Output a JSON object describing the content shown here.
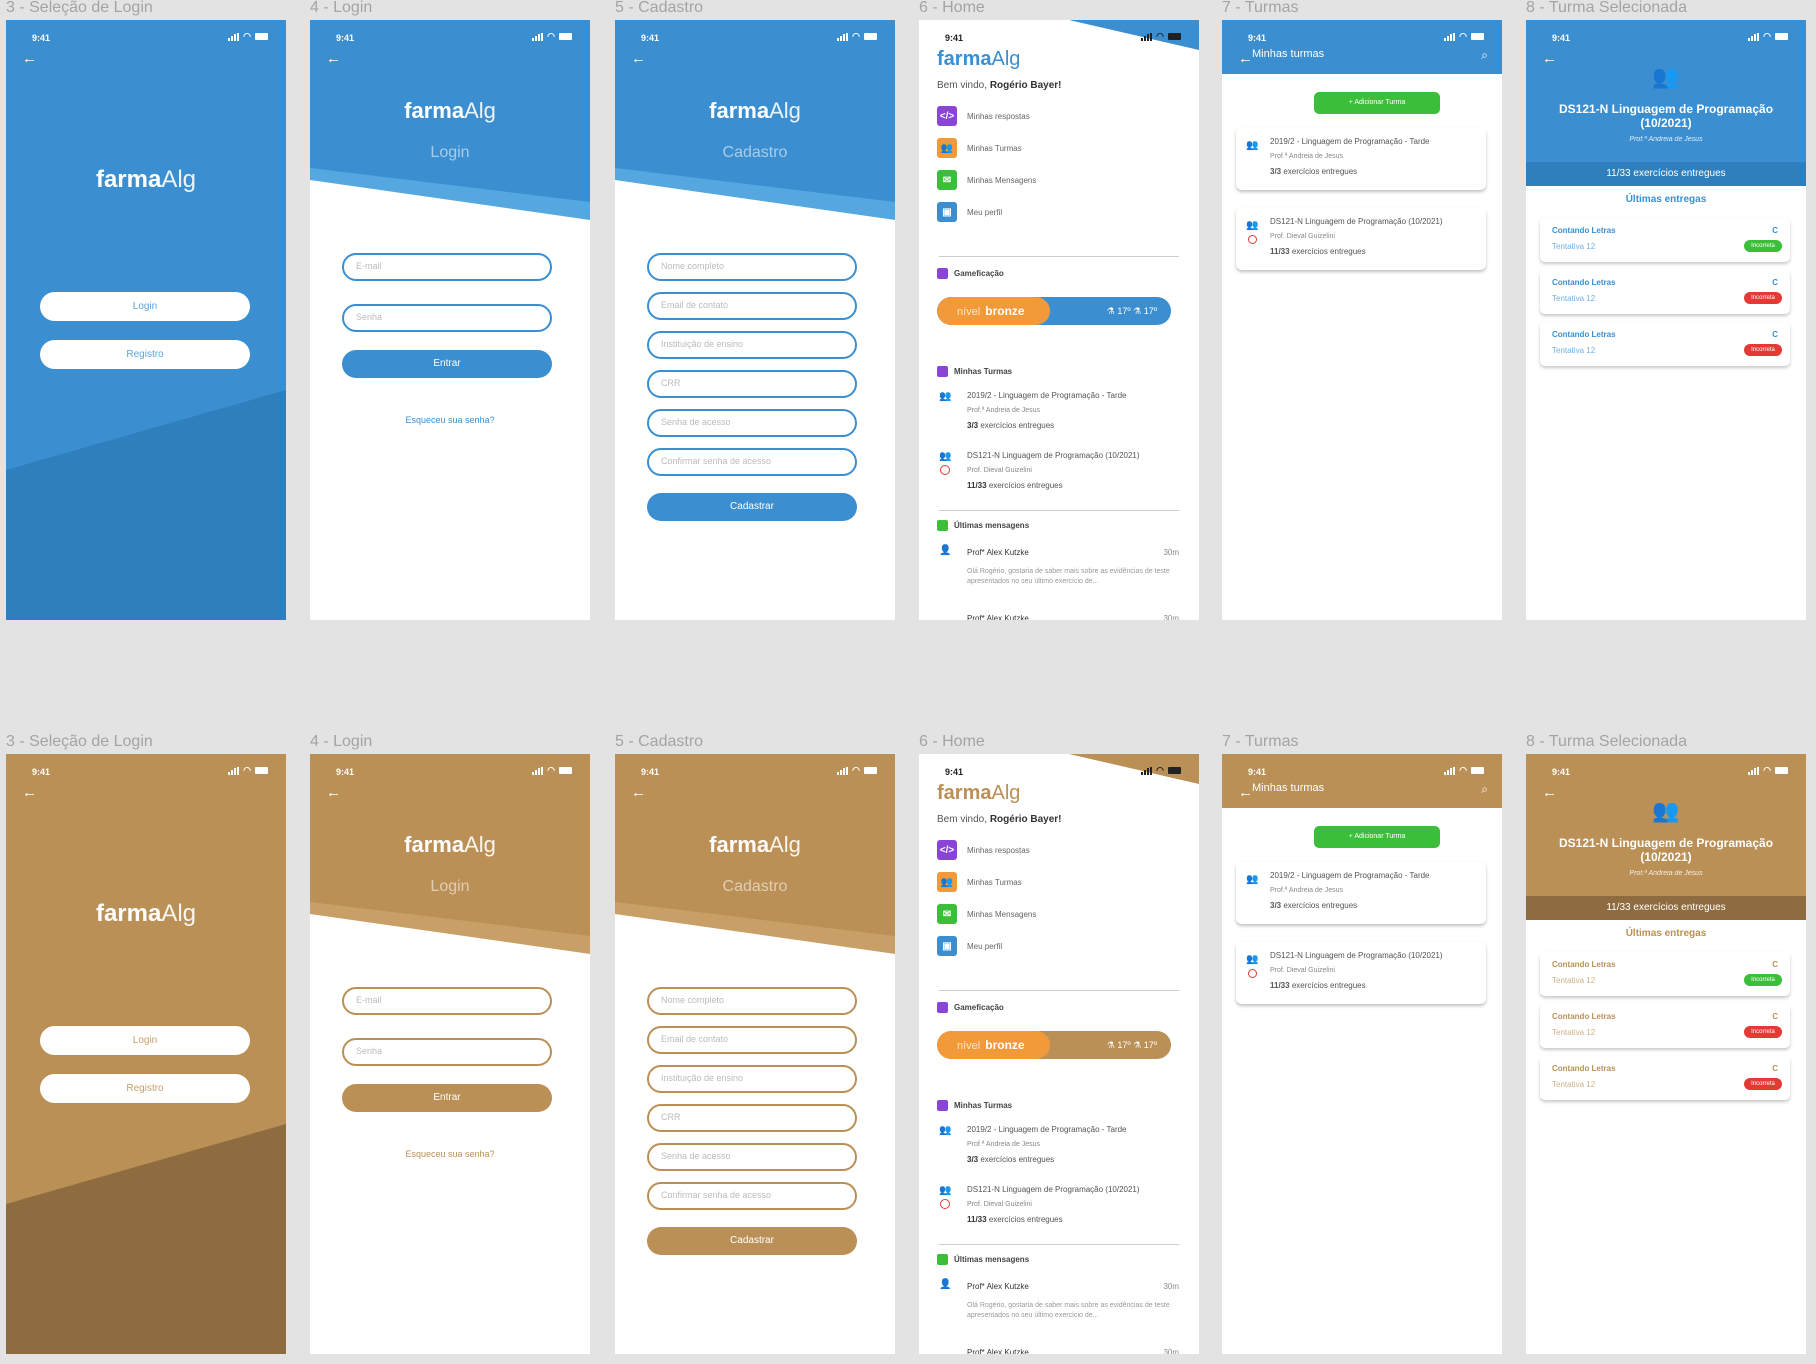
{
  "colors": {
    "blue": "#3b8fd0",
    "blue_light": "#55a7e0",
    "blue_dark": "#2f7fbd",
    "gold": "#bb9056",
    "gold_light": "#c89f67",
    "gold_dark": "#8f6c3f",
    "correct": "#3bbf3b",
    "incorrect": "#e53935"
  },
  "frame_titles": {
    "selecao": "3 - Seleção de Login",
    "login": "4 - Login",
    "cadastro": "5 - Cadastro",
    "home": "6 - Home",
    "turmas": "7 - Turmas",
    "turma_sel": "8 - Turma Selecionada"
  },
  "status": {
    "time": "9:41"
  },
  "icons": {
    "back": "arrow-left-icon",
    "search": "search-icon",
    "group": "users-icon",
    "clock": "alarm-icon"
  },
  "logo": {
    "bold": "farma",
    "light": "Alg"
  },
  "selecao": {
    "login_button": "Login",
    "register_button": "Registro"
  },
  "login": {
    "subtitle": "Login",
    "email_placeholder": "E-mail",
    "password_placeholder": "Senha",
    "submit": "Entrar",
    "forgot": "Esqueceu sua senha?"
  },
  "cadastro": {
    "subtitle": "Cadastro",
    "fields": [
      "Nome completo",
      "Email de contato",
      "Instituição de ensino",
      "CRR",
      "Senha de acesso",
      "Confirmar senha de acesso"
    ],
    "submit": "Cadastrar"
  },
  "home": {
    "welcome_prefix": "Bem vindo, ",
    "user_name": "Rogério Bayer!",
    "menu": [
      "Minhas respostas",
      "Minhas Turmas",
      "Minhas Mensagens",
      "Meu perfil"
    ],
    "gamification_title": "Gameficação",
    "level_prefix": "nível",
    "level_name": "bronze",
    "level_stats": "⚗ 17º  ⚗ 17º",
    "classes_title": "Minhas Turmas",
    "messages_title": "Últimas mensagens",
    "classes": [
      {
        "name": "2019/2 - Linguagem de Programação - Tarde",
        "prof": "Prof.ª Andreia de Jesus",
        "progress": "3/3",
        "progress_label": "exercícios entregues"
      },
      {
        "name": "DS121-N Linguagem de Programação (10/2021)",
        "prof": "Prof. Dieval Guizelini",
        "progress": "11/33",
        "progress_label": "exercícios entregues"
      }
    ],
    "message": {
      "author": "Prof* Alex Kutzke",
      "time": "30m",
      "text": "Olá Rogério, gostaria de saber mais sobre as evidências de teste apresentados no seu último exercício de..."
    },
    "message2": {
      "author": "Prof* Alex Kutzke",
      "time": "30m"
    }
  },
  "turmas": {
    "header_title": "Minhas turmas",
    "add_button": "Adicionar Turma",
    "classes": [
      {
        "name": "2019/2 - Linguagem de Programação - Tarde",
        "prof": "Prof.ª Andreia de Jesus",
        "progress": "3/3",
        "progress_label": "exercícios entregues"
      },
      {
        "name": "DS121-N Linguagem de Programação (10/2021)",
        "prof": "Prof. Dieval Guizelini",
        "progress": "11/33",
        "progress_label": "exercícios entregues"
      }
    ]
  },
  "turma_sel": {
    "title": "DS121-N Linguagem de Programação (10/2021)",
    "prof": "Prof.ª Andreia de Jesus",
    "progress_text": "11/33 exercícios entregues",
    "last_title": "Últimas entregas",
    "entries": [
      {
        "name": "Contando Letras",
        "grade": "C",
        "attempt": "Tentativa 12",
        "status": "Incorreta",
        "status_color": "#3bbf3b"
      },
      {
        "name": "Contando Letras",
        "grade": "C",
        "attempt": "Tentativa 12",
        "status": "Incorreta",
        "status_color": "#e53935"
      },
      {
        "name": "Contando Letras",
        "grade": "C",
        "attempt": "Tentativa 12",
        "status": "Incorreta",
        "status_color": "#e53935"
      }
    ]
  }
}
